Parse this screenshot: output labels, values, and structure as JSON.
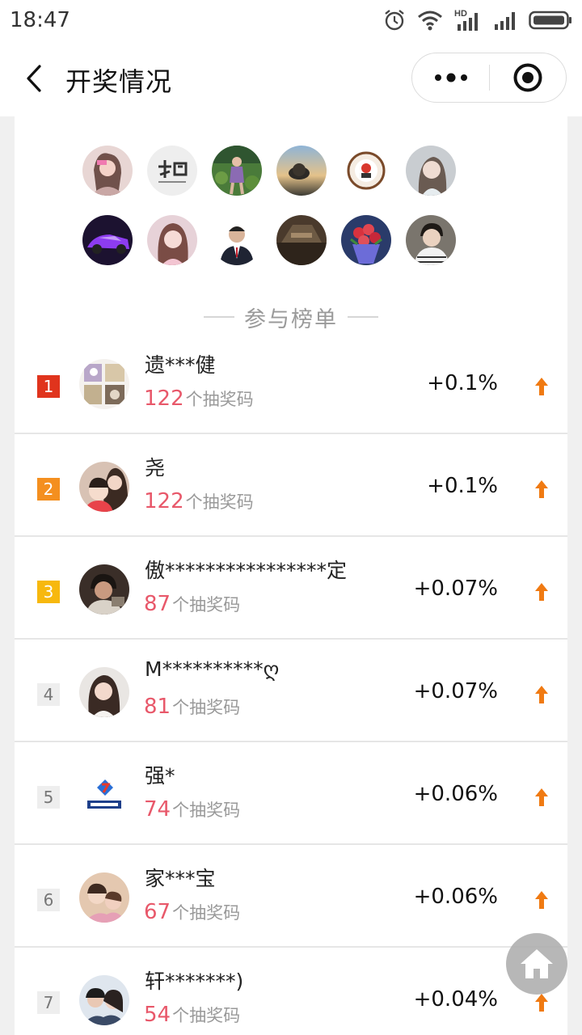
{
  "status_bar": {
    "time": "18:47",
    "icons": [
      "alarm-icon",
      "wifi-icon",
      "hd-signal-icon",
      "signal-icon",
      "battery-icon"
    ],
    "hd_label": "HD"
  },
  "nav": {
    "title": "开奖情况",
    "back_icon": "chevron-left-icon",
    "more_icon": "more-dots-icon",
    "close_icon": "target-close-icon"
  },
  "participants": [
    {
      "name": "avatar-1"
    },
    {
      "name": "avatar-2"
    },
    {
      "name": "avatar-3"
    },
    {
      "name": "avatar-4"
    },
    {
      "name": "avatar-5"
    },
    {
      "name": "avatar-6"
    },
    {
      "name": "avatar-7"
    },
    {
      "name": "avatar-8"
    },
    {
      "name": "avatar-9"
    },
    {
      "name": "avatar-10"
    },
    {
      "name": "avatar-11"
    },
    {
      "name": "avatar-12"
    }
  ],
  "ranking": {
    "title": "参与榜单",
    "unit_label": "个抽奖码",
    "items": [
      {
        "rank": "1",
        "name": "遗***健",
        "codes": "122",
        "percent": "+0.1%"
      },
      {
        "rank": "2",
        "name": "尧",
        "codes": "122",
        "percent": "+0.1%"
      },
      {
        "rank": "3",
        "name": "傲****************定",
        "codes": "87",
        "percent": "+0.07%"
      },
      {
        "rank": "4",
        "name": "M**********ღ",
        "codes": "81",
        "percent": "+0.07%"
      },
      {
        "rank": "5",
        "name": "强*",
        "codes": "74",
        "percent": "+0.06%"
      },
      {
        "rank": "6",
        "name": "家***宝",
        "codes": "67",
        "percent": "+0.06%"
      },
      {
        "rank": "7",
        "name": "轩*******)",
        "codes": "54",
        "percent": "+0.04%"
      }
    ]
  },
  "colors": {
    "rank1": "#e0341d",
    "rank2": "#f48f1f",
    "rank3": "#f7b80e",
    "code_count": "#e8586a",
    "arrow": "#f07a12"
  },
  "home_icon": "home-icon"
}
